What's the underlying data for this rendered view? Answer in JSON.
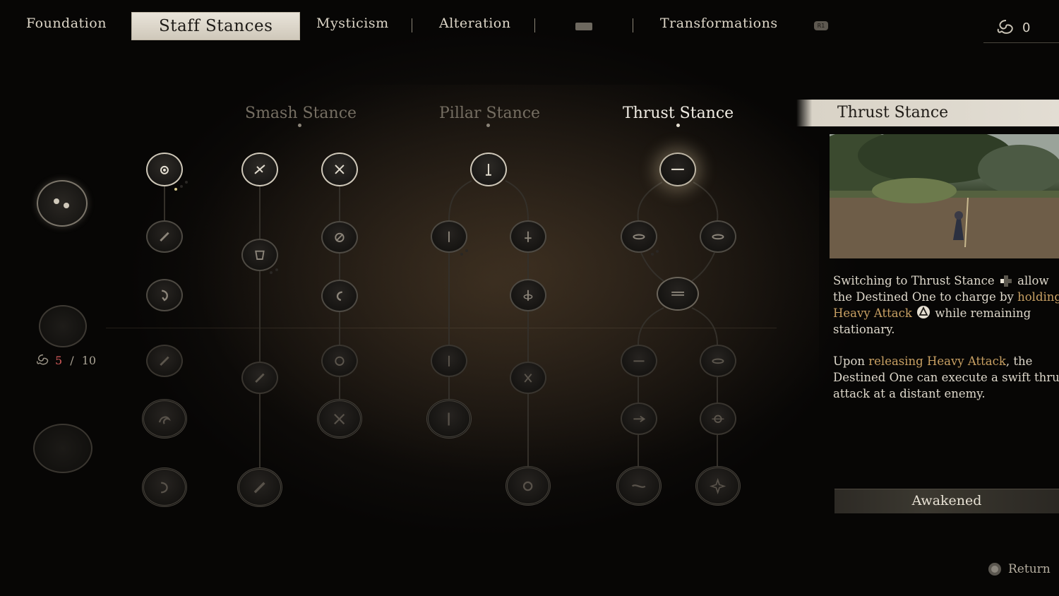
{
  "nav": {
    "tabs": [
      {
        "label": "Foundation"
      },
      {
        "label": "Staff Stances",
        "active": true
      },
      {
        "label": "Mysticism"
      },
      {
        "label": "Alteration"
      },
      {
        "label": "Transformations"
      }
    ],
    "bumper_hint": "R1",
    "currency_value": "0"
  },
  "left": {
    "points_current": "5",
    "points_sep": " / ",
    "points_max": "10"
  },
  "stances": [
    {
      "label": "Smash Stance",
      "active": false
    },
    {
      "label": "Pillar Stance",
      "active": false
    },
    {
      "label": "Thrust Stance",
      "active": true
    }
  ],
  "panel": {
    "title": "Thrust Stance",
    "p1_a": "Switching to Thrust Stance",
    "p1_b": "allow",
    "p1_c": "the Destined One to charge by",
    "p1_hl1": "holding",
    "p1_hl2": "Heavy Attack",
    "p1_d": "while remaining",
    "p1_e": "stationary.",
    "p2_a": "Upon",
    "p2_hl": "releasing Heavy Attack",
    "p2_b": ", the",
    "p2_c": "Destined One can execute a swift thru",
    "p2_d": "attack at a distant enemy.",
    "status": "Awakened"
  },
  "footer": {
    "return_label": "Return"
  },
  "colors": {
    "accent": "#c8a063",
    "points_current": "#d35a5a",
    "tab_active_bg": "#e2ddd3"
  },
  "icons": [
    "spirit-swirl-icon",
    "dpad-left-icon",
    "triangle-button-icon",
    "circle-button-icon",
    "treasure-chest-icon"
  ]
}
